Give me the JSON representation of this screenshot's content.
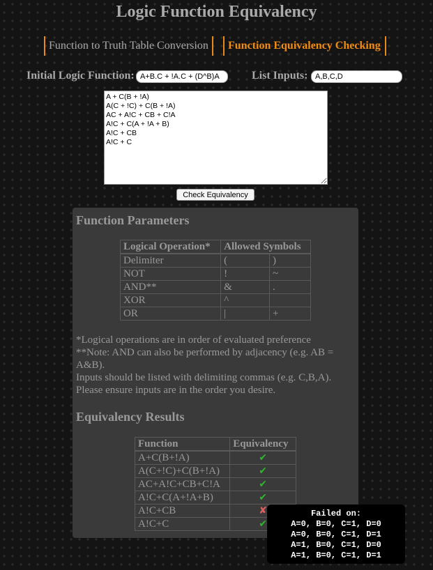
{
  "title": "Logic Function Equivalency",
  "tabs": [
    {
      "label": "Function to Truth Table Conversion",
      "active": false
    },
    {
      "label": "Function Equivalency Checking",
      "active": true
    }
  ],
  "form": {
    "initial_label": "Initial Logic Function:",
    "initial_value": "A+B.C + !A.C + (D^B)A",
    "inputs_label": "List Inputs:",
    "inputs_value": "A,B,C,D",
    "functions_text": "A + C(B + !A)\nA(C + !C) + C(B + !A)\nAC + A!C + CB + C!A\nA!C + C(A + !A + B)\nA!C + CB\nA!C + C",
    "check_button": "Check Equivalency"
  },
  "parameters": {
    "heading": "Function Parameters",
    "headers": [
      "Logical Operation*",
      "Allowed Symbols"
    ],
    "rows": [
      {
        "op": "Delimiter",
        "s1": "(",
        "s2": ")"
      },
      {
        "op": "NOT",
        "s1": "!",
        "s2": "~"
      },
      {
        "op": "AND**",
        "s1": "&",
        "s2": "."
      },
      {
        "op": "XOR",
        "s1": "^",
        "s2": ""
      },
      {
        "op": "OR",
        "s1": "|",
        "s2": "+"
      }
    ],
    "notes": [
      "*Logical operations are in order of evaluated preference",
      "**Note: AND can also be performed by adjacency (e.g. AB = A&B).",
      "Inputs should be listed with delimiting commas (e.g. C,B,A).",
      "Please ensure inputs are in the order you desire."
    ]
  },
  "results": {
    "heading": "Equivalency Results",
    "headers": [
      "Function",
      "Equivalency"
    ],
    "rows": [
      {
        "func": "A+C(B+!A)",
        "equivalent": true,
        "symbol": "✔"
      },
      {
        "func": "A(C+!C)+C(B+!A)",
        "equivalent": true,
        "symbol": "✔"
      },
      {
        "func": "AC+A!C+CB+C!A",
        "equivalent": true,
        "symbol": "✔"
      },
      {
        "func": "A!C+C(A+!A+B)",
        "equivalent": true,
        "symbol": "✔"
      },
      {
        "func": "A!C+CB",
        "equivalent": false,
        "symbol": "✘"
      },
      {
        "func": "A!C+C",
        "equivalent": true,
        "symbol": "✔"
      }
    ]
  },
  "tooltip": {
    "heading": "Failed on:",
    "lines": [
      "A=0, B=0, C=1, D=0",
      "A=0, B=0, C=1, D=1",
      "A=1, B=0, C=1, D=0",
      "A=1, B=0, C=1, D=1"
    ]
  },
  "colors": {
    "accent": "#f08c14",
    "check": "#2fb52f",
    "cross": "#e06060",
    "panel": "#3a3a3a"
  }
}
